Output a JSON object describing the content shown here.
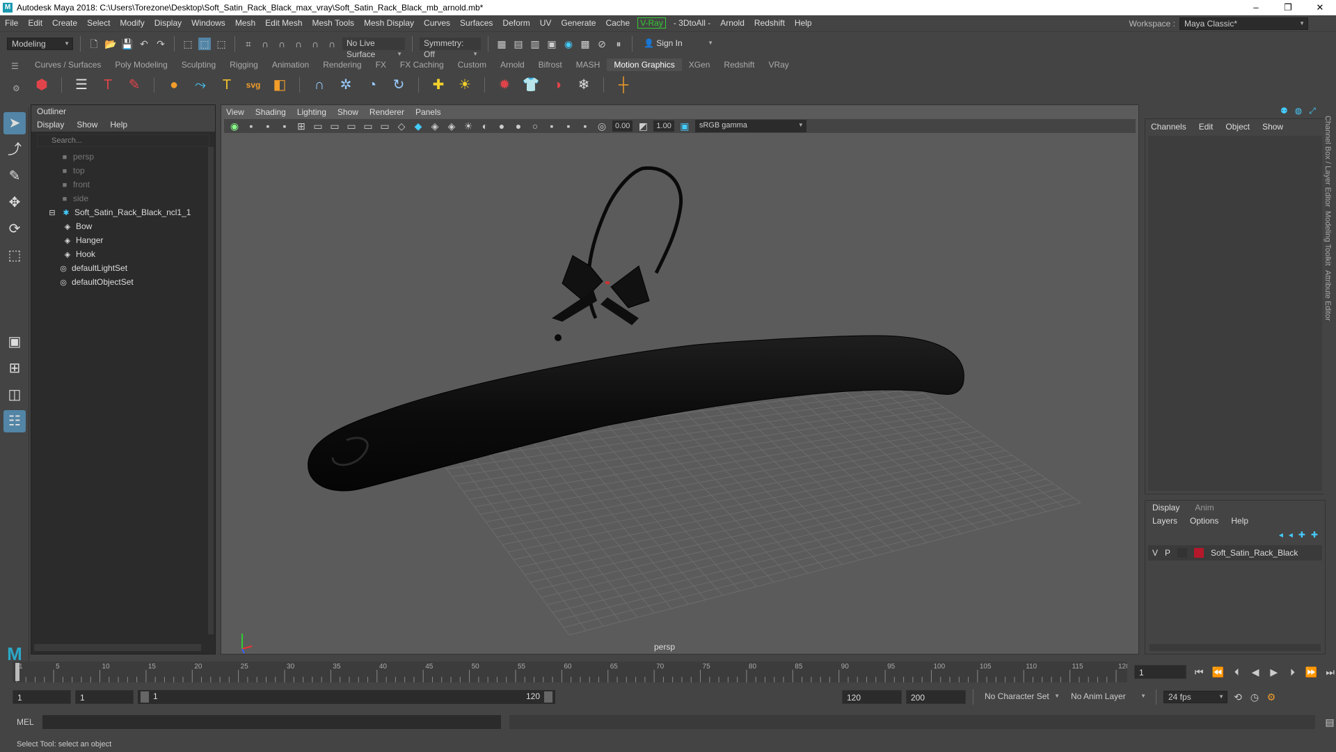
{
  "title_bar": {
    "text": "Autodesk Maya 2018: C:\\Users\\Torezone\\Desktop\\Soft_Satin_Rack_Black_max_vray\\Soft_Satin_Rack_Black_mb_arnold.mb*"
  },
  "menu": [
    "File",
    "Edit",
    "Create",
    "Select",
    "Modify",
    "Display",
    "Windows",
    "Mesh",
    "Edit Mesh",
    "Mesh Tools",
    "Mesh Display",
    "Curves",
    "Surfaces",
    "Deform",
    "UV",
    "Generate",
    "Cache"
  ],
  "menu_vray": "V-Ray",
  "menu_tail": [
    "- 3DtoAll -",
    "Arnold",
    "Redshift",
    "Help"
  ],
  "workspace": {
    "label": "Workspace :",
    "value": "Maya Classic*"
  },
  "status": {
    "mode": "Modeling",
    "live_surface": "No Live Surface",
    "symmetry": "Symmetry: Off",
    "sign_in": "Sign In"
  },
  "shelf_tabs": [
    "Curves / Surfaces",
    "Poly Modeling",
    "Sculpting",
    "Rigging",
    "Animation",
    "Rendering",
    "FX",
    "FX Caching",
    "Custom",
    "Arnold",
    "Bifrost",
    "MASH",
    "Motion Graphics",
    "XGen",
    "Redshift",
    "VRay"
  ],
  "shelf_active": "Motion Graphics",
  "outliner": {
    "title": "Outliner",
    "menus": [
      "Display",
      "Show",
      "Help"
    ],
    "search_placeholder": "Search...",
    "cameras": [
      "persp",
      "top",
      "front",
      "side"
    ],
    "group": "Soft_Satin_Rack_Black_ncl1_1",
    "children": [
      "Bow",
      "Hanger",
      "Hook"
    ],
    "sets": [
      "defaultLightSet",
      "defaultObjectSet"
    ]
  },
  "viewport": {
    "menus": [
      "View",
      "Shading",
      "Lighting",
      "Show",
      "Renderer",
      "Panels"
    ],
    "exposure": "0.00",
    "gamma": "1.00",
    "color_space": "sRGB gamma",
    "camera": "persp"
  },
  "channel_box": {
    "menus": [
      "Channels",
      "Edit",
      "Object",
      "Show"
    ]
  },
  "side_tabs": [
    "Channel Box / Layer Editor",
    "Modeling Toolkit",
    "Attribute Editor"
  ],
  "layer_editor": {
    "tabs": [
      "Display",
      "Anim"
    ],
    "menus": [
      "Layers",
      "Options",
      "Help"
    ],
    "layer": {
      "v": "V",
      "p": "P",
      "name": "Soft_Satin_Rack_Black",
      "color": "#b4182a"
    }
  },
  "timeline": {
    "ticks": [
      "1",
      "5",
      "10",
      "15",
      "20",
      "25",
      "30",
      "35",
      "40",
      "45",
      "50",
      "55",
      "60",
      "65",
      "70",
      "75",
      "80",
      "85",
      "90",
      "95",
      "100",
      "105",
      "110",
      "115",
      "120"
    ],
    "current_frame": "1"
  },
  "range": {
    "start": "1",
    "range_start": "1",
    "slider_start": "1",
    "slider_end": "120",
    "range_end": "120",
    "end": "200",
    "character_set": "No Character Set",
    "anim_layer": "No Anim Layer",
    "fps": "24 fps"
  },
  "cmd": {
    "label": "MEL"
  },
  "help_line": "Select Tool: select an object"
}
